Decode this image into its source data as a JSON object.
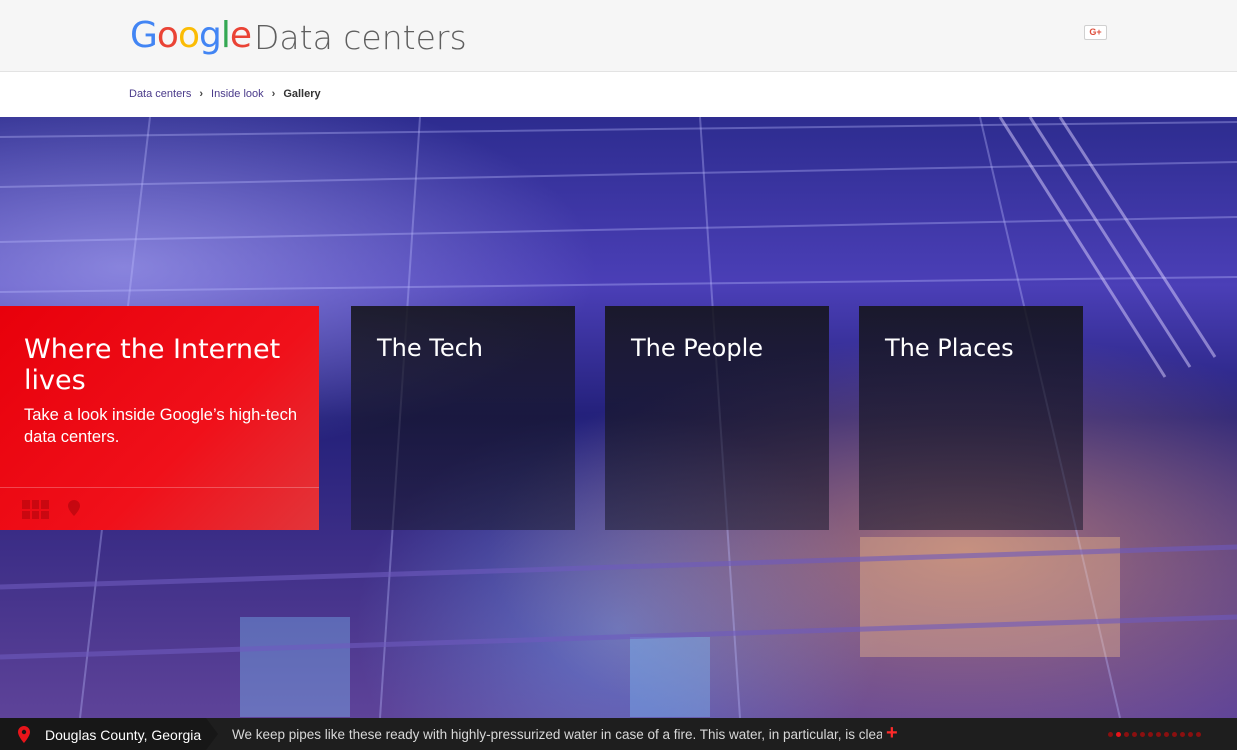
{
  "header": {
    "logo_letters": [
      {
        "char": "G",
        "color": "#4285F4"
      },
      {
        "char": "o",
        "color": "#EA4335"
      },
      {
        "char": "o",
        "color": "#FBBC05"
      },
      {
        "char": "g",
        "color": "#4285F4"
      },
      {
        "char": "l",
        "color": "#34A853"
      },
      {
        "char": "e",
        "color": "#EA4335"
      }
    ],
    "site_title": "Data centers",
    "share_label": "G+"
  },
  "breadcrumb": {
    "items": [
      "Data centers",
      "Inside look"
    ],
    "separator": "›",
    "current": "Gallery"
  },
  "hero": {
    "feature": {
      "title": "Where the Internet lives",
      "description": "Take a look inside Google’s high-tech data centers.",
      "accent": "#E8000B"
    },
    "tiles": [
      {
        "title": "The Tech"
      },
      {
        "title": "The People"
      },
      {
        "title": "The Places"
      }
    ]
  },
  "footer": {
    "location": "Douglas County, Georgia",
    "caption": "We keep pipes like these ready with highly-pressurized water in case of a fire. This water, in particular, is cleaned",
    "more_label": "+",
    "slide_count": 12,
    "active_slide": 1
  }
}
